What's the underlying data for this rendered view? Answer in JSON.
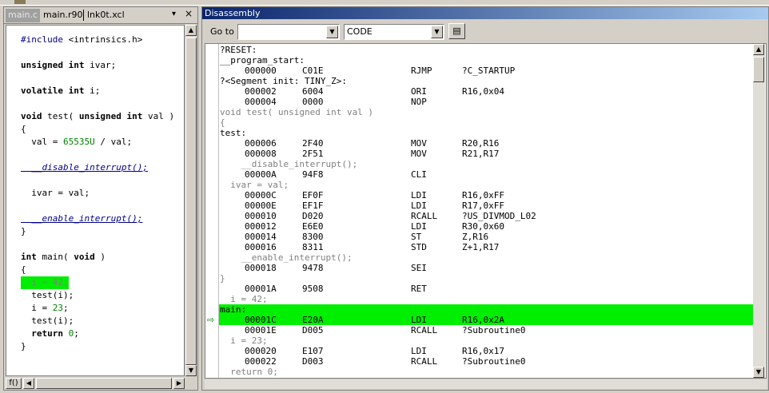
{
  "left": {
    "tabs": [
      "main.c",
      "main.r90",
      "lnk0t.xcl"
    ],
    "close_glyph": "×",
    "menu_glyph": "▾",
    "bottom_label": "f()",
    "code_lines": [
      {
        "t": "#include <intrinsics.h>",
        "style": "normal"
      },
      {
        "t": "",
        "style": "normal"
      },
      {
        "t": "unsigned int ivar;",
        "style": "normal"
      },
      {
        "t": "",
        "style": "normal"
      },
      {
        "t": "volatile int i;",
        "style": "normal"
      },
      {
        "t": "",
        "style": "normal"
      },
      {
        "t": "void test( unsigned int val )",
        "style": "normal"
      },
      {
        "t": "{",
        "style": "normal"
      },
      {
        "t": "  val = 65535U / val;",
        "style": "normal"
      },
      {
        "t": "",
        "style": "normal"
      },
      {
        "t": "  __disable_interrupt();",
        "style": "italic"
      },
      {
        "t": "",
        "style": "normal"
      },
      {
        "t": "  ivar = val;",
        "style": "normal"
      },
      {
        "t": "",
        "style": "normal"
      },
      {
        "t": "  __enable_interrupt();",
        "style": "italic"
      },
      {
        "t": "}",
        "style": "normal"
      },
      {
        "t": "",
        "style": "normal"
      },
      {
        "t": "int main( void )",
        "style": "normal"
      },
      {
        "t": "{",
        "style": "normal"
      },
      {
        "t": "  i = 42;",
        "style": "highlight"
      },
      {
        "t": "  test(i);",
        "style": "normal"
      },
      {
        "t": "  i = 23;",
        "style": "normal"
      },
      {
        "t": "  test(i);",
        "style": "normal"
      },
      {
        "t": "  return 0;",
        "style": "normal"
      },
      {
        "t": "}",
        "style": "normal"
      }
    ]
  },
  "disassembly": {
    "title": "Disassembly",
    "goto_label": "Go to",
    "goto_value": "",
    "memory_value": "CODE",
    "highlight_color": "#00ee00",
    "lines": [
      {
        "kind": "label",
        "text": "?RESET:"
      },
      {
        "kind": "label",
        "text": "__program_start:"
      },
      {
        "kind": "instr",
        "addr": "000000",
        "hex": "C01E",
        "op": "RJMP",
        "arg": "?C_STARTUP"
      },
      {
        "kind": "label",
        "text": "?<Segment init: TINY_Z>:"
      },
      {
        "kind": "instr",
        "addr": "000002",
        "hex": "6004",
        "op": "ORI",
        "arg": "R16,0x04"
      },
      {
        "kind": "instr",
        "addr": "000004",
        "hex": "0000",
        "op": "NOP",
        "arg": ""
      },
      {
        "kind": "src",
        "text": "void test( unsigned int val )"
      },
      {
        "kind": "src",
        "text": "{"
      },
      {
        "kind": "label",
        "text": "test:"
      },
      {
        "kind": "instr",
        "addr": "000006",
        "hex": "2F40",
        "op": "MOV",
        "arg": "R20,R16"
      },
      {
        "kind": "instr",
        "addr": "000008",
        "hex": "2F51",
        "op": "MOV",
        "arg": "R21,R17"
      },
      {
        "kind": "src",
        "text": "    __disable_interrupt();"
      },
      {
        "kind": "instr",
        "addr": "00000A",
        "hex": "94F8",
        "op": "CLI",
        "arg": ""
      },
      {
        "kind": "src",
        "text": "  ivar = val;"
      },
      {
        "kind": "instr",
        "addr": "00000C",
        "hex": "EF0F",
        "op": "LDI",
        "arg": "R16,0xFF"
      },
      {
        "kind": "instr",
        "addr": "00000E",
        "hex": "EF1F",
        "op": "LDI",
        "arg": "R17,0xFF"
      },
      {
        "kind": "instr",
        "addr": "000010",
        "hex": "D020",
        "op": "RCALL",
        "arg": "?US_DIVMOD_L02"
      },
      {
        "kind": "instr",
        "addr": "000012",
        "hex": "E6E0",
        "op": "LDI",
        "arg": "R30,0x60"
      },
      {
        "kind": "instr",
        "addr": "000014",
        "hex": "8300",
        "op": "ST",
        "arg": "Z,R16"
      },
      {
        "kind": "instr",
        "addr": "000016",
        "hex": "8311",
        "op": "STD",
        "arg": "Z+1,R17"
      },
      {
        "kind": "src",
        "text": "    __enable_interrupt();"
      },
      {
        "kind": "instr",
        "addr": "000018",
        "hex": "9478",
        "op": "SEI",
        "arg": ""
      },
      {
        "kind": "src",
        "text": "}"
      },
      {
        "kind": "instr",
        "addr": "00001A",
        "hex": "9508",
        "op": "RET",
        "arg": ""
      },
      {
        "kind": "src",
        "text": "  i = 42;"
      },
      {
        "kind": "label",
        "text": "main:",
        "hl": true
      },
      {
        "kind": "instr",
        "addr": "00001C",
        "hex": "E20A",
        "op": "LDI",
        "arg": "R16,0x2A",
        "hl": true,
        "arrow": true
      },
      {
        "kind": "instr",
        "addr": "00001E",
        "hex": "D005",
        "op": "RCALL",
        "arg": "?Subroutine0"
      },
      {
        "kind": "src",
        "text": "  i = 23;"
      },
      {
        "kind": "instr",
        "addr": "000020",
        "hex": "E107",
        "op": "LDI",
        "arg": "R16,0x17"
      },
      {
        "kind": "instr",
        "addr": "000022",
        "hex": "D003",
        "op": "RCALL",
        "arg": "?Subroutine0"
      },
      {
        "kind": "src",
        "text": "  return 0;"
      }
    ]
  }
}
